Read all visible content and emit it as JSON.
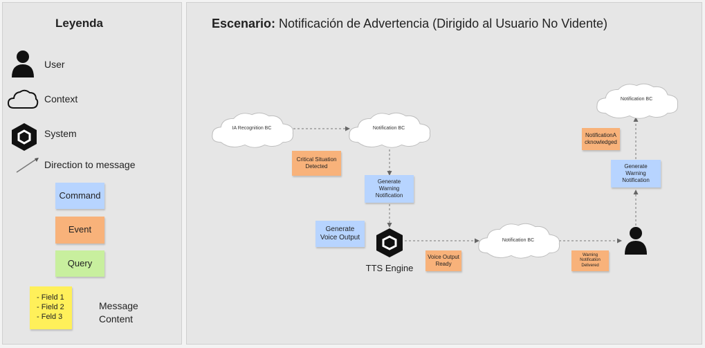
{
  "legend": {
    "title": "Leyenda",
    "items": {
      "user": "User",
      "context": "Context",
      "system": "System",
      "direction": "Direction to message"
    },
    "command": "Command",
    "event": "Event",
    "query": "Query",
    "note_lines": [
      "- Field 1",
      "- Field 2",
      "- Feld 3"
    ],
    "message_content": [
      "Message",
      "Content"
    ]
  },
  "scenario": {
    "title_bold": "Escenario:",
    "title_rest": " Notificación de Advertencia (Dirigido al Usuario No Vidente)"
  },
  "diagram": {
    "clouds": {
      "ia_recognition": "IA Recognition BC",
      "notification_top": "Notification BC",
      "notification_mid": "Notification BC",
      "notification_right": "Notification BC"
    },
    "events": {
      "critical": [
        "Critical Situation",
        "Detected"
      ],
      "voice_ready": [
        "Voice Output",
        "Ready"
      ],
      "warning_delivered": [
        "Warning",
        "Notification",
        "Delivered"
      ],
      "acknowledged": [
        "NotificationA",
        "cknowledged"
      ]
    },
    "commands": {
      "generate_warning_1": [
        "Generate",
        "Warning",
        "Notification"
      ],
      "generate_voice": [
        "Generate",
        "Voice Output"
      ],
      "generate_warning_2": [
        "Generate",
        "Warning",
        "Notification"
      ]
    },
    "system_label": "TTS Engine"
  },
  "colors": {
    "command": "#b7d4ff",
    "event": "#f8b27a",
    "query": "#c8ef9e",
    "note": "#fff05a"
  }
}
